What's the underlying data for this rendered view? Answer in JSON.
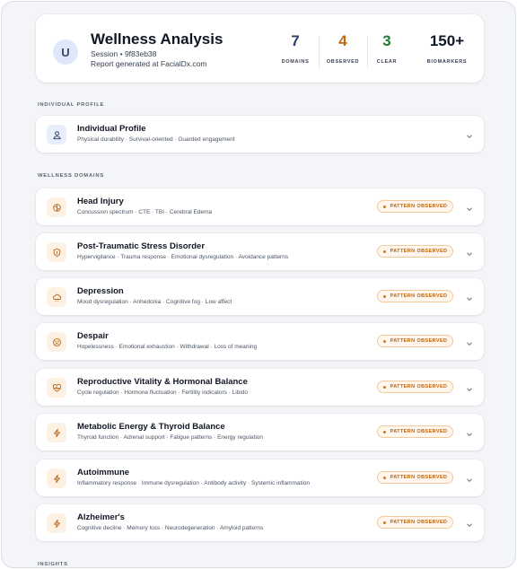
{
  "header": {
    "avatar_letter": "U",
    "title": "Wellness Analysis",
    "session": "Session • 9f83eb38",
    "report": "Report generated at FacialDx.com",
    "stats": [
      {
        "value": "7",
        "label": "DOMAINS",
        "color": "#2d3f66"
      },
      {
        "value": "4",
        "label": "OBSERVED",
        "color": "#c2680c"
      },
      {
        "value": "3",
        "label": "CLEAR",
        "color": "#1f7a36"
      },
      {
        "value": "150+",
        "label": "BIOMARKERS",
        "color": "#111827"
      }
    ]
  },
  "sections": {
    "profile_label": "INDIVIDUAL PROFILE",
    "domains_label": "WELLNESS DOMAINS",
    "insights_label": "INSIGHTS"
  },
  "profile": {
    "title": "Individual Profile",
    "subtitle": "Physical durability · Survival-oriented · Guarded engagement",
    "icon": "user-icon"
  },
  "domains": [
    {
      "title": "Head Injury",
      "subtitle": "Concussion spectrum · CTE · TBI · Cerebral Edema",
      "badge": "PATTERN OBSERVED",
      "icon": "brain-icon"
    },
    {
      "title": "Post-Traumatic Stress Disorder",
      "subtitle": "Hypervigilance · Trauma response · Emotional dysregulation · Avoidance patterns",
      "badge": "PATTERN OBSERVED",
      "icon": "shield-icon"
    },
    {
      "title": "Depression",
      "subtitle": "Mood dysregulation · Anhedonia · Cognitive fog · Low affect",
      "badge": "PATTERN OBSERVED",
      "icon": "cloud-icon"
    },
    {
      "title": "Despair",
      "subtitle": "Hopelessness · Emotional exhaustion · Withdrawal · Loss of meaning",
      "badge": "PATTERN OBSERVED",
      "icon": "sad-face-icon"
    },
    {
      "title": "Reproductive Vitality & Hormonal Balance",
      "subtitle": "Cycle regulation · Hormone fluctuation · Fertility indicators · Libido",
      "badge": "PATTERN OBSERVED",
      "icon": "heart-pulse-icon"
    },
    {
      "title": "Metabolic Energy & Thyroid Balance",
      "subtitle": "Thyroid function · Adrenal support · Fatigue patterns · Energy regulation",
      "badge": "PATTERN OBSERVED",
      "icon": "bolt-icon"
    },
    {
      "title": "Autoimmune",
      "subtitle": "Inflammatory response · Immune dysregulation · Antibody activity · Systemic inflammation",
      "badge": "PATTERN OBSERVED",
      "icon": "bolt-icon"
    },
    {
      "title": "Alzheimer's",
      "subtitle": "Cognitive decline · Memory loss · Neurodegeneration · Amyloid patterns",
      "badge": "PATTERN OBSERVED",
      "icon": "bolt-icon"
    }
  ]
}
